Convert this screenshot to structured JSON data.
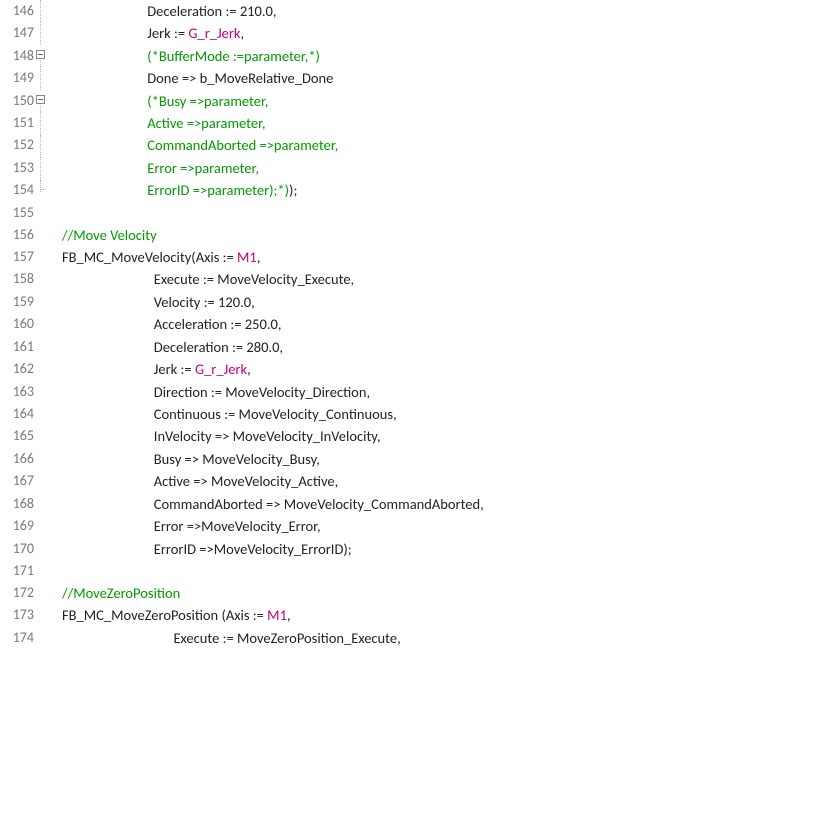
{
  "editor": {
    "first_line": 146,
    "lines": [
      {
        "n": 146,
        "segs": [
          {
            "t": "                          Deceleration := 210.0,",
            "c": "plain"
          }
        ],
        "vline": true
      },
      {
        "n": 147,
        "segs": [
          {
            "t": "                          Jerk := ",
            "c": "plain"
          },
          {
            "t": "G_r_Jerk",
            "c": "var"
          },
          {
            "t": ",",
            "c": "plain"
          }
        ],
        "vline": true
      },
      {
        "n": 148,
        "segs": [
          {
            "t": "                          ",
            "c": "plain"
          },
          {
            "t": "(*BufferMode :=parameter,*)",
            "c": "comment"
          }
        ],
        "vline": true,
        "fold": true
      },
      {
        "n": 149,
        "segs": [
          {
            "t": "                          Done => b_MoveRelative_Done",
            "c": "plain"
          }
        ],
        "vline": true
      },
      {
        "n": 150,
        "segs": [
          {
            "t": "                          ",
            "c": "plain"
          },
          {
            "t": "(*Busy =>parameter,",
            "c": "comment"
          }
        ],
        "vline": true,
        "fold": true
      },
      {
        "n": 151,
        "segs": [
          {
            "t": "                          ",
            "c": "plain"
          },
          {
            "t": "Active =>parameter,",
            "c": "comment"
          }
        ],
        "vline": true
      },
      {
        "n": 152,
        "segs": [
          {
            "t": "                          ",
            "c": "plain"
          },
          {
            "t": "CommandAborted =>parameter,",
            "c": "comment"
          }
        ],
        "vline": true
      },
      {
        "n": 153,
        "segs": [
          {
            "t": "                          ",
            "c": "plain"
          },
          {
            "t": "Error =>parameter,",
            "c": "comment"
          }
        ],
        "vline": true
      },
      {
        "n": 154,
        "segs": [
          {
            "t": "                          ",
            "c": "plain"
          },
          {
            "t": "ErrorID =>parameter);*)",
            "c": "comment"
          },
          {
            "t": ");",
            "c": "plain"
          }
        ],
        "vline": true,
        "vend": true
      },
      {
        "n": 155,
        "segs": [
          {
            "t": "",
            "c": "plain"
          }
        ]
      },
      {
        "n": 156,
        "segs": [
          {
            "t": "",
            "c": "plain"
          },
          {
            "t": "//Move Velocity",
            "c": "comment"
          }
        ]
      },
      {
        "n": 157,
        "segs": [
          {
            "t": "FB_MC_MoveVelocity(Axis := ",
            "c": "plain"
          },
          {
            "t": "M1",
            "c": "var"
          },
          {
            "t": ",",
            "c": "plain"
          }
        ]
      },
      {
        "n": 158,
        "segs": [
          {
            "t": "                            Execute := MoveVelocity_Execute,",
            "c": "plain"
          }
        ]
      },
      {
        "n": 159,
        "segs": [
          {
            "t": "                            Velocity := 120.0,",
            "c": "plain"
          }
        ]
      },
      {
        "n": 160,
        "segs": [
          {
            "t": "                            Acceleration := 250.0,",
            "c": "plain"
          }
        ]
      },
      {
        "n": 161,
        "segs": [
          {
            "t": "                            Deceleration := 280.0,",
            "c": "plain"
          }
        ]
      },
      {
        "n": 162,
        "segs": [
          {
            "t": "                            Jerk := ",
            "c": "plain"
          },
          {
            "t": "G_r_Jerk",
            "c": "var"
          },
          {
            "t": ",",
            "c": "plain"
          }
        ]
      },
      {
        "n": 163,
        "segs": [
          {
            "t": "                            Direction := MoveVelocity_Direction,",
            "c": "plain"
          }
        ]
      },
      {
        "n": 164,
        "segs": [
          {
            "t": "                            Continuous := MoveVelocity_Continuous,",
            "c": "plain"
          }
        ]
      },
      {
        "n": 165,
        "segs": [
          {
            "t": "                            InVelocity => MoveVelocity_InVelocity,",
            "c": "plain"
          }
        ]
      },
      {
        "n": 166,
        "segs": [
          {
            "t": "                            Busy => MoveVelocity_Busy,",
            "c": "plain"
          }
        ]
      },
      {
        "n": 167,
        "segs": [
          {
            "t": "                            Active => MoveVelocity_Active,",
            "c": "plain"
          }
        ]
      },
      {
        "n": 168,
        "segs": [
          {
            "t": "                            CommandAborted => MoveVelocity_CommandAborted,",
            "c": "plain"
          }
        ]
      },
      {
        "n": 169,
        "segs": [
          {
            "t": "                            Error =>MoveVelocity_Error,",
            "c": "plain"
          }
        ]
      },
      {
        "n": 170,
        "segs": [
          {
            "t": "                            ErrorID =>MoveVelocity_ErrorID);",
            "c": "plain"
          }
        ]
      },
      {
        "n": 171,
        "segs": [
          {
            "t": "",
            "c": "plain"
          }
        ]
      },
      {
        "n": 172,
        "segs": [
          {
            "t": "",
            "c": "plain"
          },
          {
            "t": "//MoveZeroPosition",
            "c": "comment"
          }
        ]
      },
      {
        "n": 173,
        "segs": [
          {
            "t": "FB_MC_MoveZeroPosition (Axis := ",
            "c": "plain"
          },
          {
            "t": "M1",
            "c": "var"
          },
          {
            "t": ",",
            "c": "plain"
          }
        ]
      },
      {
        "n": 174,
        "segs": [
          {
            "t": "                                  Execute := MoveZeroPosition_Execute,",
            "c": "plain"
          }
        ]
      }
    ]
  }
}
